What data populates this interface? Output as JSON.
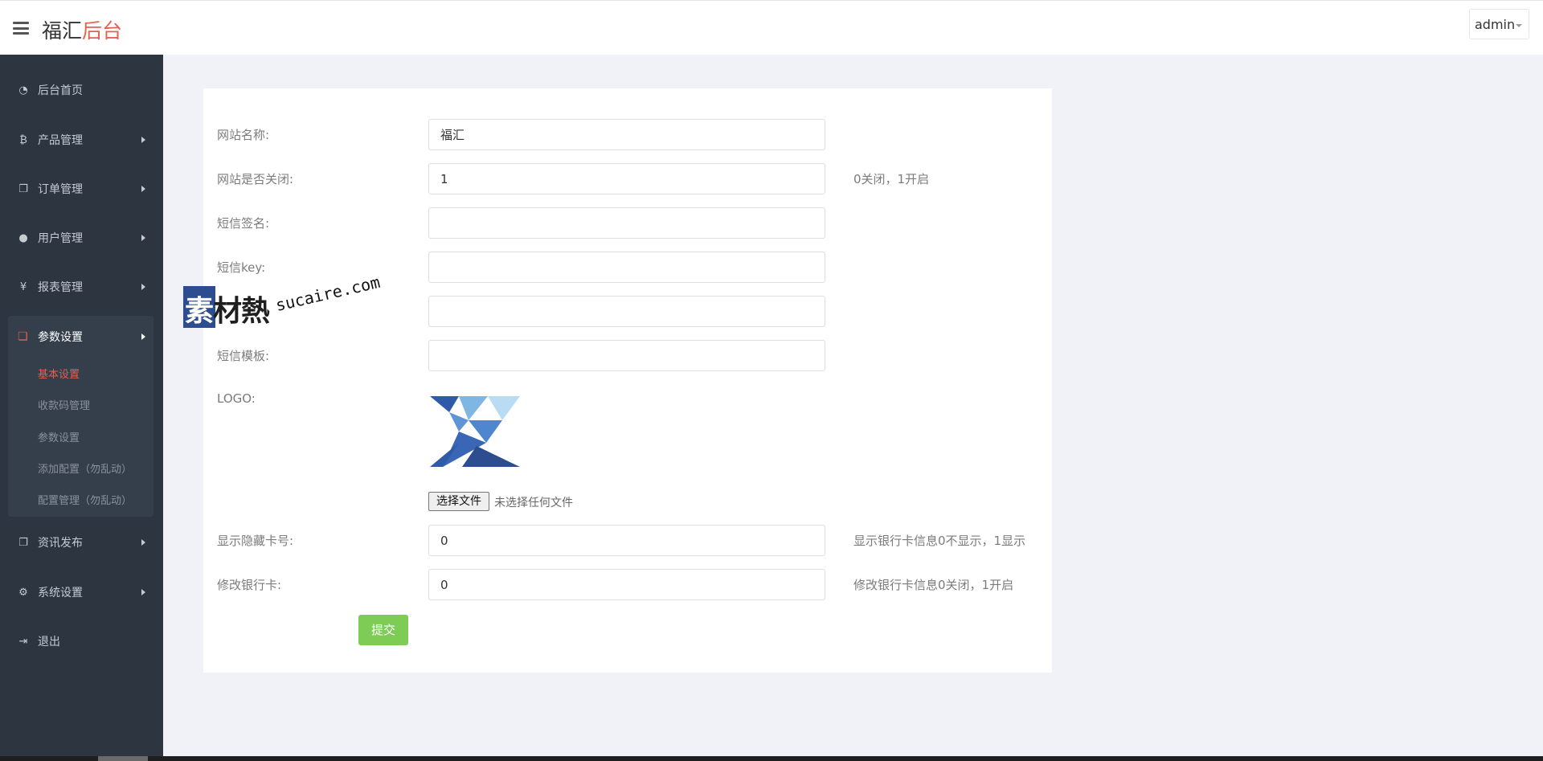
{
  "header": {
    "brand_main": "福汇",
    "brand_accent": "后台",
    "user": "admin"
  },
  "sidebar": {
    "items": [
      {
        "label": "后台首页",
        "icon": "dashboard-icon"
      },
      {
        "label": "产品管理",
        "icon": "bitcoin-icon"
      },
      {
        "label": "订单管理",
        "icon": "copy-icon"
      },
      {
        "label": "用户管理",
        "icon": "user-icon"
      },
      {
        "label": "报表管理",
        "icon": "yen-icon"
      },
      {
        "label": "参数设置",
        "icon": "files-icon"
      },
      {
        "label": "资讯发布",
        "icon": "copy-icon"
      },
      {
        "label": "系统设置",
        "icon": "gears-icon"
      },
      {
        "label": "退出",
        "icon": "sign-out-icon"
      }
    ],
    "subitems": [
      "基本设置",
      "收款码管理",
      "参数设置",
      "添加配置（勿乱动）",
      "配置管理（勿乱动）"
    ]
  },
  "form": {
    "site_name": {
      "label": "网站名称:",
      "value": "福汇"
    },
    "site_closed": {
      "label": "网站是否关闭:",
      "value": "1",
      "hint": "0关闭，1开启"
    },
    "sms_sign": {
      "label": "短信签名:",
      "value": ""
    },
    "sms_key": {
      "label": "短信key:",
      "value": ""
    },
    "sms_id": {
      "value": ""
    },
    "sms_template": {
      "label": "短信模板:",
      "value": ""
    },
    "logo": {
      "label": "LOGO:"
    },
    "file_button": "选择文件",
    "file_status": "未选择任何文件",
    "show_card": {
      "label": "显示隐藏卡号:",
      "value": "0",
      "hint": "显示银行卡信息0不显示，1显示"
    },
    "edit_card": {
      "label": "修改银行卡:",
      "value": "0",
      "hint": "修改银行卡信息0关闭，1开启"
    },
    "submit": "提交"
  },
  "watermark": {
    "text_first": "素",
    "text_rest": "材熱",
    "url": "sucaire.com"
  },
  "colors": {
    "accent": "#e8604c",
    "sidebar": "#2d3541",
    "submit": "#7ecb56",
    "page_bg": "#f0f2f7"
  }
}
